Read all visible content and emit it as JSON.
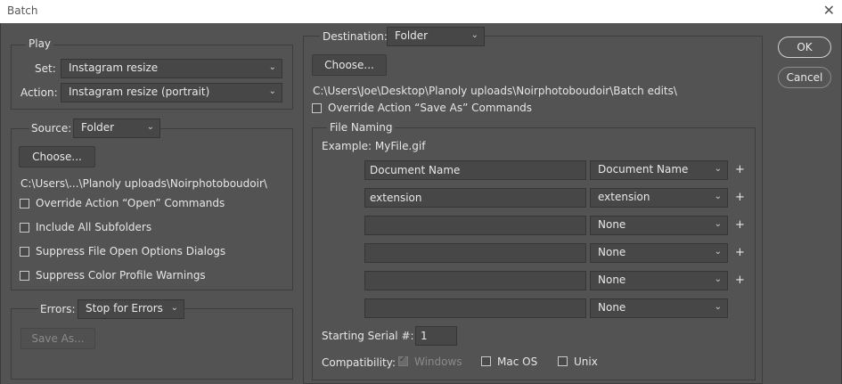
{
  "window": {
    "title": "Batch",
    "close": "✕"
  },
  "play": {
    "legend": "Play",
    "set_label": "Set:",
    "set_value": "Instagram resize",
    "action_label": "Action:",
    "action_value": "Instagram resize (portrait)"
  },
  "source": {
    "label": "Source:",
    "value": "Folder",
    "choose": "Choose...",
    "path": "C:\\Users\\...\\Planoly uploads\\Noirphotoboudoir\\",
    "options": [
      "Override Action “Open” Commands",
      "Include All Subfolders",
      "Suppress File Open Options Dialogs",
      "Suppress Color Profile Warnings"
    ]
  },
  "errors": {
    "label": "Errors:",
    "value": "Stop for Errors",
    "save_as": "Save As..."
  },
  "destination": {
    "label": "Destination:",
    "value": "Folder",
    "choose": "Choose...",
    "path": "C:\\Users\\Joe\\Desktop\\Planoly uploads\\Noirphotoboudoir\\Batch edits\\",
    "override": "Override Action “Save As” Commands"
  },
  "file_naming": {
    "legend": "File Naming",
    "example": "Example: MyFile.gif",
    "rows": [
      {
        "text": "Document Name",
        "select": "Document Name",
        "plus": "+"
      },
      {
        "text": "extension",
        "select": "extension",
        "plus": "+"
      },
      {
        "text": "",
        "select": "None",
        "plus": "+"
      },
      {
        "text": "",
        "select": "None",
        "plus": "+"
      },
      {
        "text": "",
        "select": "None",
        "plus": "+"
      },
      {
        "text": "",
        "select": "None",
        "plus": ""
      }
    ],
    "serial_label": "Starting Serial #:",
    "serial_value": "1",
    "compat_label": "Compatibility:",
    "compat_windows": "Windows",
    "compat_mac": "Mac OS",
    "compat_unix": "Unix"
  },
  "buttons": {
    "ok": "OK",
    "cancel": "Cancel"
  }
}
